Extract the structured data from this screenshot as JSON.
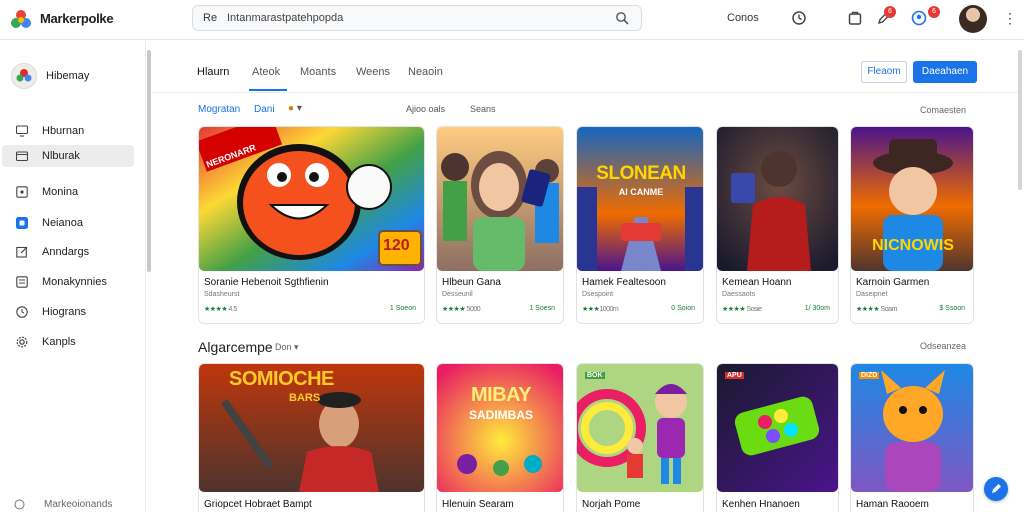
{
  "app": {
    "name": "Markerpolke",
    "brand_color": "#1a73e8"
  },
  "search": {
    "prefix": "Re",
    "value": "Intanmarastpatehpopda"
  },
  "topbar": {
    "link": "Conos",
    "badges": [
      "6",
      "6"
    ]
  },
  "sidebar": {
    "profile_name": "Hibemay",
    "items": [
      {
        "label": "Hburnan",
        "icon": "monitor-icon"
      },
      {
        "label": "Nlburak",
        "icon": "folder-icon",
        "active": true
      },
      {
        "label": "Monina",
        "icon": "box-icon"
      },
      {
        "label": "Neianoa",
        "icon": "blue-app-icon"
      },
      {
        "label": "Anndargs",
        "icon": "edit-icon"
      },
      {
        "label": "Monakynnies",
        "icon": "list-icon"
      },
      {
        "label": "Hiograns",
        "icon": "clock-icon"
      },
      {
        "label": "Kanpls",
        "icon": "gear-icon"
      }
    ],
    "footer": "Markeoionands"
  },
  "tabs": [
    "Hlaurn",
    "Ateok",
    "Moants",
    "Weens",
    "Neaoin"
  ],
  "header_buttons": {
    "outline": "Fleaom",
    "primary": "Daeahaen"
  },
  "filters": {
    "primary": "Mogratan",
    "secondary": "Dani",
    "items": [
      "Ajioo oals",
      "Seans"
    ],
    "see_all": "Comaesten"
  },
  "row1": [
    {
      "title": "Soranie Hebenoit Sgthfienin",
      "sub": "Sdasheurst",
      "rating": "4.5",
      "price": "1 Soeon",
      "banner": "NERONARR",
      "badge": "120"
    },
    {
      "title": "Hlbeun Gana",
      "sub": "Desseunil",
      "rating": "5000",
      "price": "1 Soesn"
    },
    {
      "title": "Hamek Fealtesoon",
      "sub": "Dsespoint",
      "rating": "1000m",
      "price": "0 Soion",
      "poster_line1": "SLONEAN",
      "poster_line2": "AI CANME"
    },
    {
      "title": "Kemean Hoann",
      "sub": "Daessaots",
      "rating": "Sosie",
      "price": "1/ 30om"
    },
    {
      "title": "Karnoin Garmen",
      "sub": "Daseipnet",
      "rating": "Soam",
      "price": "$ Ssoon",
      "poster": "NICNOWIS"
    }
  ],
  "section2": {
    "title": "Algarcempe",
    "sub": "Don",
    "see_all": "Odseanzea"
  },
  "row2": [
    {
      "title": "Griopcet Hobraet Bampt",
      "poster_line1": "SOMIOCHE",
      "poster_line2": "BARS"
    },
    {
      "title": "Hlenuin Searam",
      "poster_line1": "MIBAY",
      "poster_line2": "SADIMBAS"
    },
    {
      "title": "Norjah Pome",
      "tag": "BOK"
    },
    {
      "title": "Kenhen Hnanoen",
      "tag": "APU"
    },
    {
      "title": "Haman Raooem",
      "tag": "DIZD"
    }
  ]
}
